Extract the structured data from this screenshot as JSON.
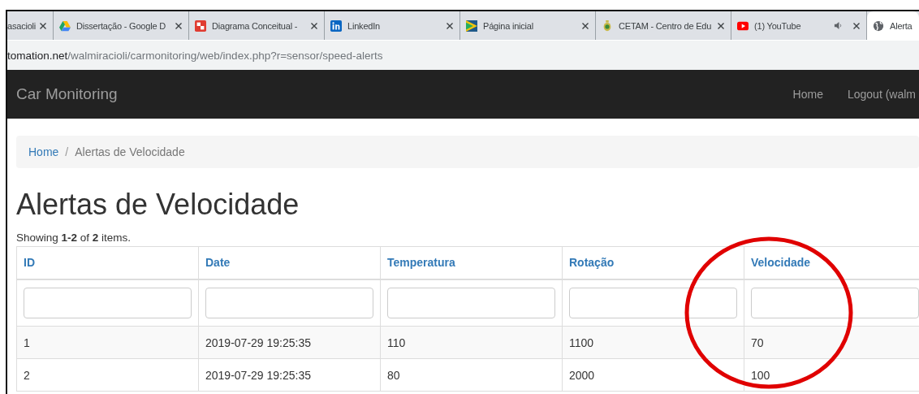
{
  "browser": {
    "tabs": [
      {
        "title": "asacioli",
        "kind": "none",
        "selected": false,
        "audio": false
      },
      {
        "title": "Dissertação - Google D",
        "kind": "drive",
        "selected": false,
        "audio": false
      },
      {
        "title": "Diagrama Conceitual -",
        "kind": "diagram",
        "selected": false,
        "audio": false
      },
      {
        "title": "LinkedIn",
        "kind": "linkedin",
        "selected": false,
        "audio": false
      },
      {
        "title": "Página inicial",
        "kind": "flag",
        "selected": false,
        "audio": false
      },
      {
        "title": "CETAM - Centro de Edu",
        "kind": "emblem",
        "selected": false,
        "audio": false
      },
      {
        "title": "(1) YouTube",
        "kind": "youtube",
        "selected": false,
        "audio": true
      },
      {
        "title": "Alerta",
        "kind": "globe",
        "selected": true,
        "audio": false
      }
    ],
    "address": {
      "host": "tomation.net",
      "path": "/walmiracioli/carmonitoring/web/index.php?r=sensor/speed-alerts"
    }
  },
  "navbar": {
    "brand": "Car Monitoring",
    "links": [
      "Home",
      "Logout (walm"
    ]
  },
  "breadcrumb": {
    "separator": "/",
    "items": [
      {
        "label": "Home",
        "kind": "link"
      },
      {
        "label": "Alertas de Velocidade",
        "kind": "current"
      }
    ]
  },
  "title": "Alertas de Velocidade",
  "summary": "Showing **1-2** of **2** items.",
  "table": {
    "columns": [
      "ID",
      "Date",
      "Temperatura",
      "Rotação",
      "Velocidade"
    ],
    "rows": [
      [
        "1",
        "2019-07-29 19:25:35",
        "110",
        "1100",
        "70"
      ],
      [
        "2",
        "2019-07-29 19:25:35",
        "80",
        "2000",
        "100"
      ]
    ]
  },
  "annotation": {
    "kind": "circle"
  }
}
